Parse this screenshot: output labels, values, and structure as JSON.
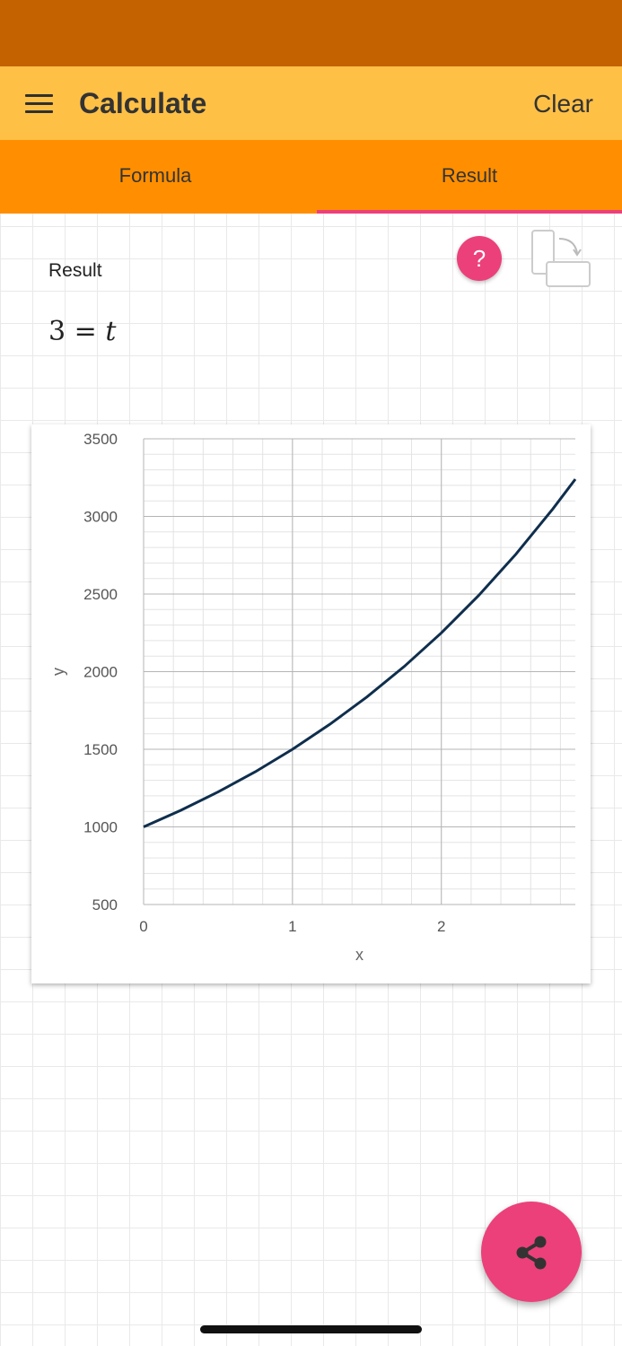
{
  "app": {
    "title": "Calculate",
    "clear_label": "Clear"
  },
  "tabs": [
    {
      "label": "Formula"
    },
    {
      "label": "Result"
    }
  ],
  "result": {
    "label": "Result",
    "equation": {
      "left": "3",
      "operator": "=",
      "right": "t"
    },
    "help_label": "?"
  },
  "icons": {
    "menu": "menu-icon",
    "rotate": "rotate-device-icon",
    "share": "share-icon"
  },
  "colors": {
    "status_bar": "#c46200",
    "app_bar": "#ffc046",
    "tab_bar": "#ff8f00",
    "accent": "#ec407a",
    "curve": "#0f2e4d"
  },
  "chart_data": {
    "type": "line",
    "xlabel": "x",
    "ylabel": "y",
    "xlim": [
      0,
      2.9
    ],
    "ylim": [
      500,
      3500
    ],
    "x_ticks": [
      "0",
      "1",
      "2"
    ],
    "y_ticks": [
      "500",
      "1000",
      "1500",
      "2000",
      "2500",
      "3000",
      "3500"
    ],
    "grid": true,
    "series": [
      {
        "x": [
          0,
          0.25,
          0.5,
          0.75,
          1,
          1.25,
          1.5,
          1.75,
          2,
          2.25,
          2.5,
          2.75,
          2.9
        ],
        "y": [
          1000,
          1107,
          1225,
          1355,
          1500,
          1660,
          1837,
          2033,
          2250,
          2490,
          2756,
          3050,
          3240
        ]
      }
    ]
  }
}
